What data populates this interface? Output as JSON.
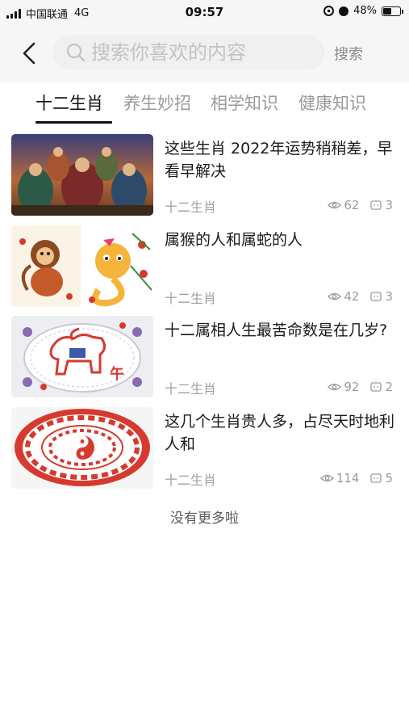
{
  "status_bar": {
    "carrier": "中国联通",
    "network": "4G",
    "time": "09:57",
    "battery": "48%",
    "battery_level": 0.48
  },
  "search": {
    "placeholder": "搜索你喜欢的内容",
    "value": "",
    "button_label": "搜索"
  },
  "tabs": [
    {
      "label": "十二生肖",
      "active": true
    },
    {
      "label": "养生妙招",
      "active": false
    },
    {
      "label": "相学知识",
      "active": false
    },
    {
      "label": "健康知识",
      "active": false
    }
  ],
  "articles": [
    {
      "title": "这些生肖 2022年运势稍稍差，早看早解决",
      "category": "十二生肖",
      "views": "62",
      "comments": "3",
      "thumb_icon": "deities-painting"
    },
    {
      "title": "属猴的人和属蛇的人",
      "category": "十二生肖",
      "views": "42",
      "comments": "3",
      "thumb_icon": "monkey-snake-papercut"
    },
    {
      "title": "十二属相人生最苦命数是在几岁?",
      "category": "十二生肖",
      "views": "92",
      "comments": "2",
      "thumb_icon": "horse-papercut"
    },
    {
      "title": "这几个生肖贵人多，占尽天时地利人和",
      "category": "十二生肖",
      "views": "114",
      "comments": "5",
      "thumb_icon": "zodiac-wheel-papercut"
    }
  ],
  "footer": {
    "end_text": "没有更多啦"
  },
  "colors": {
    "header_bg": "#f6f6f6",
    "tab_active": "#111111",
    "tab_inactive": "#9a9a9a",
    "meta_text": "#9a9a9a",
    "papercut_red": "#d63a2f"
  }
}
